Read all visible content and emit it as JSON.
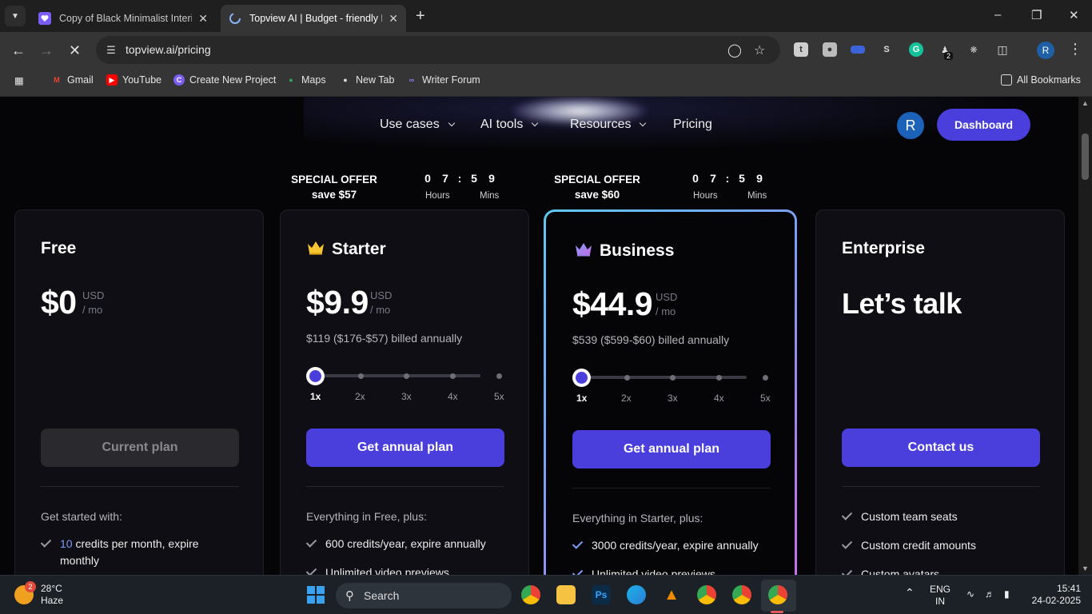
{
  "browser": {
    "tabs": [
      {
        "title": "Copy of Black Minimalist Interio",
        "active": false
      },
      {
        "title": "Topview AI | Budget - friendly P",
        "active": true
      }
    ],
    "new_tab_label": "+",
    "url": "topview.ai/pricing",
    "bookmarks": [
      "Gmail",
      "YouTube",
      "Create New Project",
      "Maps",
      "New Tab",
      "Writer Forum"
    ],
    "all_bookmarks_label": "All Bookmarks",
    "profile_initial": "R",
    "ext_badge": "2"
  },
  "site_nav": {
    "items": [
      "Use cases",
      "AI tools",
      "Resources",
      "Pricing"
    ],
    "avatar_initial": "R",
    "dashboard_label": "Dashboard"
  },
  "offers": [
    {
      "title": "SPECIAL OFFER",
      "save": "save $57",
      "digits": [
        "0",
        "7",
        ":",
        "5",
        "9"
      ],
      "hours_label": "Hours",
      "mins_label": "Mins"
    },
    {
      "title": "SPECIAL OFFER",
      "save": "save $60",
      "digits": [
        "0",
        "7",
        ":",
        "5",
        "9"
      ],
      "hours_label": "Hours",
      "mins_label": "Mins"
    }
  ],
  "plans": [
    {
      "name": "Free",
      "price": "$0",
      "currency": "USD",
      "period": "/ mo",
      "cta": "Current plan",
      "intro": "Get started with:",
      "features": [
        {
          "pre": "10",
          "text": " credits per month, expire monthly"
        }
      ]
    },
    {
      "name": "Starter",
      "price": "$9.9",
      "currency": "USD",
      "period": "/ mo",
      "billed": "$119  ($176-$57) billed annually",
      "ticks": [
        "1x",
        "2x",
        "3x",
        "4x",
        "5x"
      ],
      "cta": "Get annual plan",
      "intro": "Everything in Free, plus:",
      "features": [
        "600 credits/year, expire annually",
        "Unlimited video previews"
      ]
    },
    {
      "name": "Business",
      "price": "$44.9",
      "currency": "USD",
      "period": "/ mo",
      "billed": "$539 ($599-$60) billed annually",
      "ticks": [
        "1x",
        "2x",
        "3x",
        "4x",
        "5x"
      ],
      "cta": "Get annual plan",
      "intro": "Everything in Starter, plus:",
      "features": [
        "3000 credits/year, expire annually",
        "Unlimited video previews"
      ]
    },
    {
      "name": "Enterprise",
      "price": "Let’s talk",
      "cta": "Contact us",
      "features": [
        "Custom team seats",
        "Custom credit amounts",
        "Custom avatars"
      ]
    }
  ],
  "taskbar": {
    "weather_temp": "28°C",
    "weather_desc": "Haze",
    "weather_badge": "2",
    "search_label": "Search",
    "lang_line1": "ENG",
    "lang_line2": "IN",
    "time": "15:41",
    "date": "24-02-2025"
  },
  "colors": {
    "accent": "#4a3fdc",
    "business_border_start": "#5ec9f0",
    "business_border_end": "#c66ee8"
  }
}
